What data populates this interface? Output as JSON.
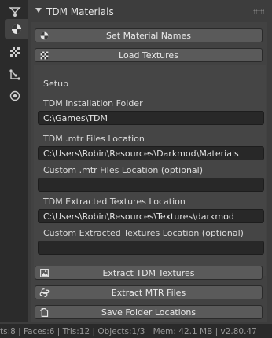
{
  "panel": {
    "title": "TDM Materials"
  },
  "buttons": {
    "set_material_names": "Set Material Names",
    "load_textures": "Load Textures",
    "extract_tdm_textures": "Extract TDM Textures",
    "extract_mtr_files": "Extract MTR Files",
    "save_folder_locations": "Save Folder Locations"
  },
  "setup": {
    "heading": "Setup",
    "install_folder_label": "TDM Installation Folder",
    "install_folder_value": "C:\\Games\\TDM",
    "mtr_location_label": "TDM .mtr Files Location",
    "mtr_location_value": "C:\\Users\\Robin\\Resources\\Darkmod\\Materials",
    "custom_mtr_label": "Custom .mtr Files Location (optional)",
    "custom_mtr_value": "",
    "extracted_textures_label": "TDM Extracted Textures Location",
    "extracted_textures_value": "C:\\Users\\Robin\\Resources\\Textures\\darkmod",
    "custom_extracted_label": "Custom Extracted Textures Location (optional)",
    "custom_extracted_value": ""
  },
  "statusbar": {
    "text": "ts:8 | Faces:6 | Tris:12 | Objects:1/3 | Mem: 42.1 MB | v2.80.47"
  },
  "icons": {
    "tab_constraint": "constraint-icon",
    "tab_material": "material-icon",
    "tab_texture": "texture-icon",
    "tab_particles": "particles-icon",
    "tab_physics": "physics-icon"
  },
  "colors": {
    "background": "#3d3d3d",
    "button": "#5a5a5a",
    "field": "#282828",
    "tabstrip": "#2b2b2b"
  }
}
